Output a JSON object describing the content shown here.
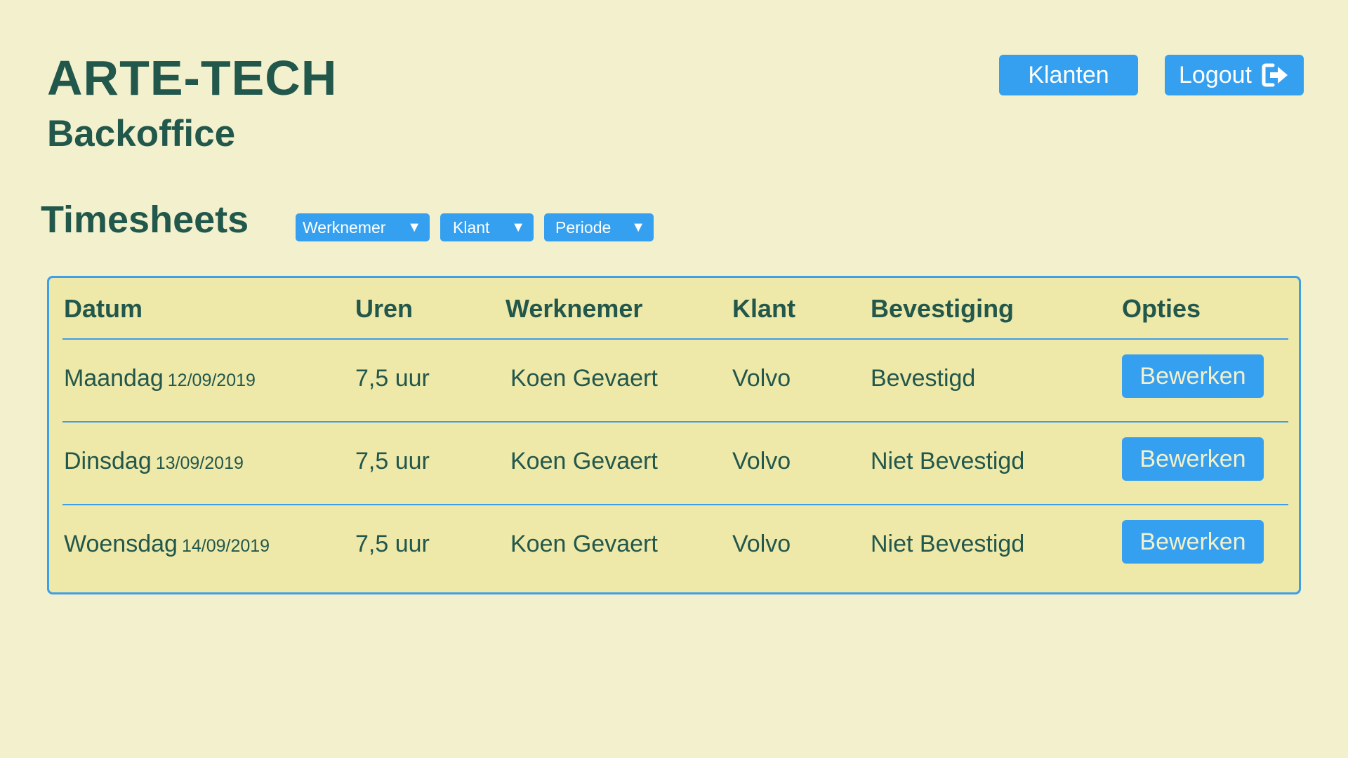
{
  "brand": {
    "title": "ARTE-TECH",
    "subtitle": "Backoffice"
  },
  "nav": {
    "klanten_label": "Klanten",
    "logout_label": "Logout",
    "logout_icon": "sign-out-icon"
  },
  "section": {
    "title": "Timesheets"
  },
  "filters": [
    {
      "label": "Werknemer",
      "icon": "caret-down-icon"
    },
    {
      "label": "Klant",
      "icon": "caret-down-icon"
    },
    {
      "label": "Periode",
      "icon": "caret-down-icon"
    }
  ],
  "table": {
    "headers": [
      "Datum",
      "Uren",
      "Werknemer",
      "Klant",
      "Bevestiging",
      "Opties"
    ],
    "rows": [
      {
        "day": "Maandag",
        "date": "12/09/2019",
        "hours": "7,5 uur",
        "employee": "Koen Gevaert",
        "client": "Volvo",
        "status": "Bevestigd",
        "action": "Bewerken"
      },
      {
        "day": "Dinsdag",
        "date": "13/09/2019",
        "hours": "7,5 uur",
        "employee": "Koen Gevaert",
        "client": "Volvo",
        "status": "Niet Bevestigd",
        "action": "Bewerken"
      },
      {
        "day": "Woensdag",
        "date": "14/09/2019",
        "hours": "7,5 uur",
        "employee": "Koen Gevaert",
        "client": "Volvo",
        "status": "Niet Bevestigd",
        "action": "Bewerken"
      }
    ]
  },
  "colors": {
    "background": "#f3f1cd",
    "table_background": "#eee8a9",
    "text": "#22574b",
    "accent": "#35a0f0"
  }
}
